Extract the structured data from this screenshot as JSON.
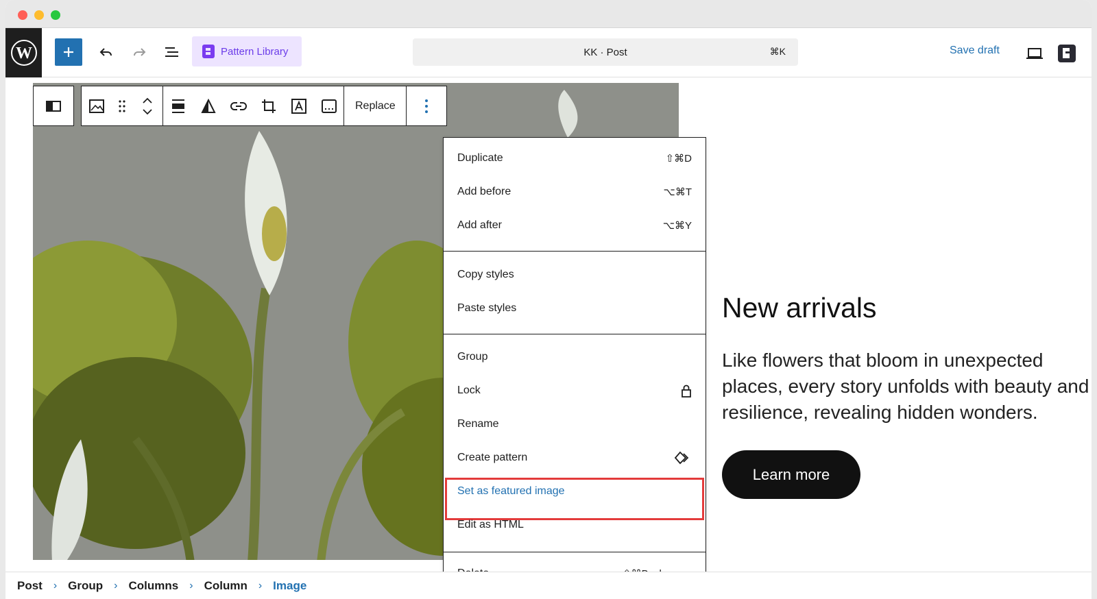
{
  "toolbar": {
    "pattern_library_label": "Pattern Library",
    "command_title": "KK · Post",
    "command_shortcut": "⌘K",
    "save_draft_label": "Save draft"
  },
  "block_toolbar": {
    "replace_label": "Replace"
  },
  "menu": {
    "items": [
      {
        "label": "Duplicate",
        "shortcut": "⇧⌘D"
      },
      {
        "label": "Add before",
        "shortcut": "⌥⌘T"
      },
      {
        "label": "Add after",
        "shortcut": "⌥⌘Y"
      },
      {
        "label": "Copy styles",
        "shortcut": ""
      },
      {
        "label": "Paste styles",
        "shortcut": ""
      },
      {
        "label": "Group",
        "shortcut": ""
      },
      {
        "label": "Lock",
        "shortcut": ""
      },
      {
        "label": "Rename",
        "shortcut": ""
      },
      {
        "label": "Create pattern",
        "shortcut": ""
      },
      {
        "label": "Set as featured image",
        "shortcut": ""
      },
      {
        "label": "Edit as HTML",
        "shortcut": ""
      },
      {
        "label": "Delete",
        "shortcut": "⇧⌘Backspace"
      }
    ]
  },
  "content": {
    "headline": "New arrivals",
    "description": "Like flowers that bloom in unexpected places, every story unfolds with beauty and resilience, revealing hidden wonders.",
    "button_label": "Learn more"
  },
  "breadcrumb": [
    "Post",
    "Group",
    "Columns",
    "Column",
    "Image"
  ],
  "colors": {
    "accent": "#2271b1",
    "highlight": "#e33b3b",
    "pattern_library_bg": "#ede4ff"
  }
}
